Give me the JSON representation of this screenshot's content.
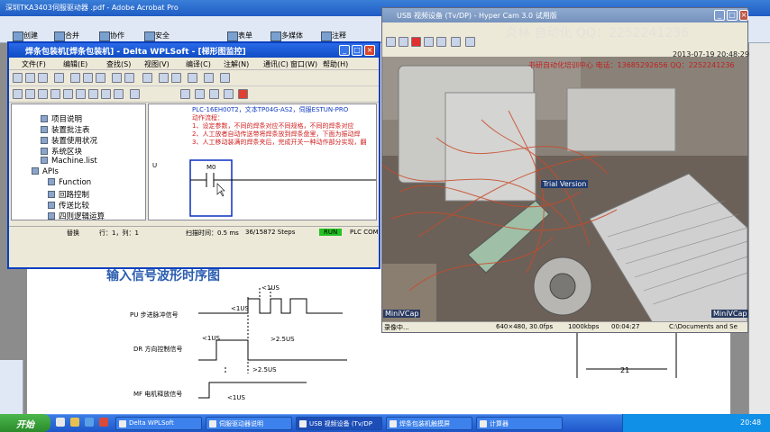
{
  "acrobat": {
    "title": "深圳TKA3403伺服驱动器 .pdf - Adobe Acrobat Pro",
    "toolbar": [
      "创建",
      "合并",
      "协作",
      "安全",
      "表单",
      "多媒体",
      "注释"
    ]
  },
  "waveform": {
    "title": "输入信号波形时序图",
    "labels": [
      "<1US",
      "<1US",
      "PU 步进脉冲信号",
      "DR 方向控制信号",
      ">2.5US",
      "<1US",
      ">2.5US",
      "MF 电机释放信号",
      "<1US"
    ],
    "dimension": "21"
  },
  "wplsoft": {
    "title": "焊条包装机[焊条包装机] - Delta WPLSoft - [梯形图监控]",
    "menu": [
      "文件(F)",
      "编辑(E)",
      "查找(S)",
      "视图(V)",
      "编译(C)",
      "注解(N)",
      "通讯(C)",
      "窗口(W)",
      "帮助(H)"
    ],
    "tree": [
      "项目说明",
      "装置批注表",
      "装置使用状况",
      "系统区块",
      "Machine.list",
      "APIs",
      "Function",
      "回路控制",
      "传送比较",
      "四则逻辑运算"
    ],
    "ladder_note": [
      "PLC-16EH00T2，文本TP04G-AS2，伺服ESTUN-PRO",
      "动作流程：",
      "1、设定参数，不同的焊条对应不同规格，不同的焊条对应",
      "2、人工放者自动传送带将焊条放到焊条盘里，下面为振动焊",
      "3、人工移动装满的焊条夹后，完成开关一种动作部分实现，翻"
    ],
    "contact": "M0",
    "rung_label": "U",
    "status": {
      "mode": "替换",
      "position": "行：1，列：1",
      "scan": "扫描时间：0.5 ms",
      "steps": "36/15872 Steps",
      "run": "RUN",
      "comm": "PLC COM"
    }
  },
  "capture": {
    "title": "USB 视频设备 (Tv/DP) - Hyper Cam 3.0 试用版",
    "overlay": "炎林 自动化 QQ：2252241236",
    "date": "2013-07-19 20:48:29",
    "info": "书研自动化培训中心 电话：13685292656 QQ：2252241236",
    "trial": "Trial Version",
    "miniv": "MiniVCap",
    "status": [
      "录像中...",
      "640×480, 30.0fps",
      "1000kbps",
      "00:04:27",
      "C:\\Documents and Se"
    ]
  },
  "taskbar": {
    "start": "开始",
    "items": [
      "Delta WPLSoft",
      "伺服驱动器说明",
      "USB 视频设备 (Tv/DP",
      "焊条包装机触摸屏",
      "计算器"
    ],
    "time": "20:48"
  },
  "colors": {
    "accent": "#0b3fc0",
    "title_blue": "#2b5db0",
    "note_red": "#d02020",
    "run_green": "#23c223"
  }
}
